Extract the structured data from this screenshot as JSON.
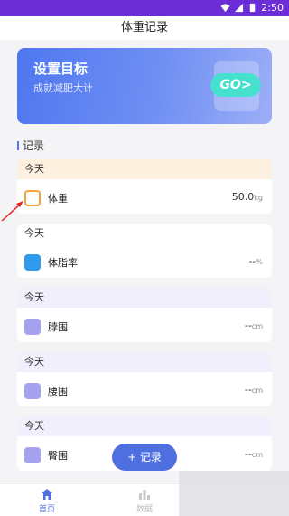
{
  "status": {
    "time": "2:50"
  },
  "header": {
    "title": "体重记录"
  },
  "banner": {
    "title": "设置目标",
    "subtitle": "成就减肥大计",
    "go_label": "GO>"
  },
  "section": {
    "title": "记录"
  },
  "cards": [
    {
      "day": "今天",
      "label": "体重",
      "value": "50.0",
      "unit": "kg",
      "icon": "scale-icon",
      "color": "#f6a23a",
      "highlight": "#fdf0de"
    },
    {
      "day": "今天",
      "label": "体脂率",
      "value": "--",
      "unit": "%",
      "icon": "fat-icon",
      "color": "#2f9bea",
      "highlight": "#ffffff"
    },
    {
      "day": "今天",
      "label": "脖围",
      "value": "--",
      "unit": "cm",
      "icon": "neck-icon",
      "color": "#a7a2ee",
      "highlight": "#f1effb"
    },
    {
      "day": "今天",
      "label": "腰围",
      "value": "--",
      "unit": "cm",
      "icon": "waist-icon",
      "color": "#a7a2ee",
      "highlight": "#f1effb"
    },
    {
      "day": "今天",
      "label": "臀围",
      "value": "--",
      "unit": "cm",
      "icon": "hip-icon",
      "color": "#a7a2ee",
      "highlight": "#f1effb"
    }
  ],
  "add_button": "+ 记录",
  "nav": [
    {
      "label": "首页",
      "icon": "home-icon",
      "active": true
    },
    {
      "label": "数据",
      "icon": "chart-icon",
      "active": false
    }
  ],
  "colors": {
    "accent": "#4f77f0",
    "statusbar": "#6a2dd6",
    "arrow": "#e02020"
  }
}
